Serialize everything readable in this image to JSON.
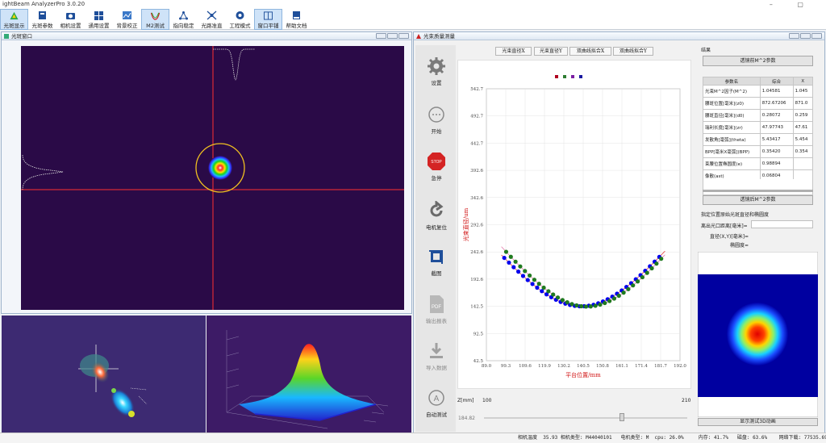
{
  "app": {
    "title": "ightBeam AnalyzerPro 3.0.20"
  },
  "toolbar": [
    {
      "label": "光斑显示",
      "icon": "beam-display-icon",
      "active": true
    },
    {
      "label": "光斑参数",
      "icon": "beam-params-icon",
      "active": false
    },
    {
      "label": "相机设置",
      "icon": "camera-icon",
      "active": false
    },
    {
      "label": "通用设置",
      "icon": "grid-settings-icon",
      "active": false
    },
    {
      "label": "背景校正",
      "icon": "background-icon",
      "active": false
    },
    {
      "label": "M2测试",
      "icon": "m2-wave-icon",
      "active": true
    },
    {
      "label": "指向稳定",
      "icon": "pointing-icon",
      "active": false
    },
    {
      "label": "光路准直",
      "icon": "collimation-icon",
      "active": false
    },
    {
      "label": "工程模式",
      "icon": "engineering-icon",
      "active": false
    },
    {
      "label": "窗口平铺",
      "icon": "tile-icon",
      "active": true
    },
    {
      "label": "帮助文档",
      "icon": "help-book-icon",
      "active": false
    }
  ],
  "beam_window": {
    "title": "光斑窗口"
  },
  "m2_window": {
    "title": "光束质量测量"
  },
  "sidebar": [
    {
      "label": "设置",
      "icon": "gear-icon",
      "disabled": false
    },
    {
      "label": "开始",
      "icon": "start-icon",
      "disabled": false
    },
    {
      "label": "急停",
      "icon": "stop-sign-icon",
      "disabled": false
    },
    {
      "label": "电机复位",
      "icon": "reset-icon",
      "disabled": false
    },
    {
      "label": "截图",
      "icon": "crop-icon",
      "disabled": false
    },
    {
      "label": "输出报表",
      "icon": "pdf-icon",
      "disabled": true
    },
    {
      "label": "导入数据",
      "icon": "import-icon",
      "disabled": true
    },
    {
      "label": "自动测试",
      "icon": "auto-test-icon",
      "disabled": false
    }
  ],
  "chart_tabs": [
    "光束直径X",
    "光束直径Y",
    "双曲线拟合X",
    "双曲线拟合Y"
  ],
  "chart_data": {
    "type": "scatter",
    "xlabel": "平台位置/mm",
    "ylabel": "光束直径/um",
    "xlim": [
      89.0,
      192.0
    ],
    "ylim": [
      42.5,
      542.7
    ],
    "xticks": [
      "89.0",
      "99.3",
      "109.6",
      "119.9",
      "130.2",
      "140.5",
      "150.8",
      "161.1",
      "171.4",
      "181.7",
      "192.0"
    ],
    "yticks": [
      "42.5",
      "92.5",
      "142.5",
      "192.6",
      "242.6",
      "292.6",
      "342.6",
      "392.6",
      "442.7",
      "492.7",
      "542.7"
    ],
    "legend_colors": [
      "#b00020",
      "#2e7d32",
      "#7b1fa2",
      "#1a1aa0"
    ],
    "grid": true,
    "series": [
      {
        "color": "#0000ee",
        "fit_color": "#e02020",
        "waist": 142.5,
        "w0": 139.5,
        "zr": 32.0,
        "x": [
          98.5,
          101.0,
          103.5,
          106.0,
          108.5,
          111.0,
          113.5,
          116.0,
          118.5,
          121.0,
          123.5,
          126.0,
          128.5,
          131.0,
          133.5,
          136.0,
          138.5,
          141.0,
          143.5,
          146.0,
          148.5,
          151.0,
          153.5,
          156.0,
          158.5,
          161.0,
          163.5,
          166.0,
          168.5,
          171.0,
          173.5,
          176.0,
          178.5,
          181.0
        ]
      },
      {
        "color": "#1f7a1f",
        "fit_color": "#e06aa0",
        "waist": 142.0,
        "w0": 142.5,
        "zr": 31.0,
        "x": [
          99.5,
          102.0,
          104.5,
          107.0,
          109.5,
          112.0,
          114.5,
          117.0,
          119.5,
          122.0,
          124.5,
          127.0,
          129.5,
          132.0,
          134.5,
          137.0,
          139.5,
          142.0,
          144.5,
          147.0,
          149.5,
          152.0,
          154.5,
          157.0,
          159.5,
          162.0,
          164.5,
          167.0,
          169.5,
          172.0,
          174.5,
          177.0,
          179.5,
          182.0
        ]
      }
    ]
  },
  "z_slider": {
    "label": "Z[mm]",
    "min": "100",
    "max": "210",
    "value": "184.82",
    "position": 0.68
  },
  "results": {
    "title": "结果",
    "transmit_header": "透镜前M^2参数",
    "transmit_footer": "透镜后M^2参数",
    "columns": [
      "参数名",
      "综合",
      "X"
    ],
    "rows": [
      [
        "光束M^2因子(M^2)",
        "1.04581",
        "1.045"
      ],
      [
        "腰斑位置[毫米](z0)",
        "872.67206",
        "871.0"
      ],
      [
        "腰斑直径[毫米](d0)",
        "0.28072",
        "0.259"
      ],
      [
        "瑞利长度[毫米](zr)",
        "47.97743",
        "47.61"
      ],
      [
        "发散角[毫弧](theta)",
        "5.43417",
        "5.454"
      ],
      [
        "BPP[毫米X毫弧](BPP)",
        "0.35420",
        "0.354"
      ],
      [
        "束腰位置椭圆度(e)",
        "0.98894",
        ""
      ],
      [
        "像散(ast)",
        "0.06804",
        ""
      ]
    ],
    "position_header": "指定位置原始光斑直径和椭圆度",
    "distance_label": "离出光口距离[毫米]=",
    "diameter_label": "直径(X,Y)[毫米]=",
    "ellipticity_label": "椭圆度=",
    "show_3d_button": "显示测试3D动画"
  },
  "status_bar": "相机温度  35.93 相机类型: M44040101   电机类型: M  cpu: 26.0%     内存: 41.7%   磁盘: 63.6%    网络下载: 77535.69kb"
}
